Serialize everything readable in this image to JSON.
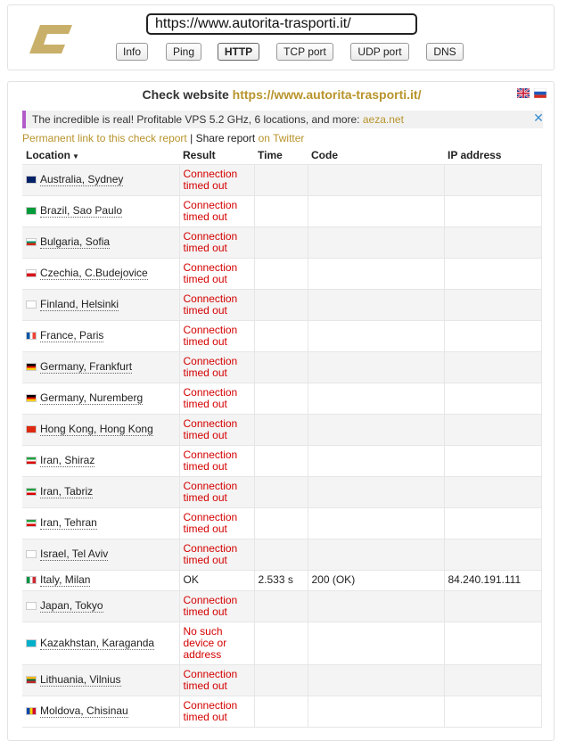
{
  "header": {
    "logo_icon": "c-letter-logo-icon",
    "url_value": "https://www.autorita-trasporti.it/",
    "tools": [
      {
        "label": "Info",
        "active": false
      },
      {
        "label": "Ping",
        "active": false
      },
      {
        "label": "HTTP",
        "active": true
      },
      {
        "label": "TCP port",
        "active": false
      },
      {
        "label": "UDP port",
        "active": false
      },
      {
        "label": "DNS",
        "active": false
      }
    ]
  },
  "check": {
    "title_prefix": "Check website",
    "title_url": "https://www.autorita-trasporti.it/",
    "language_icons": [
      "uk-flag-icon",
      "ru-flag-icon"
    ]
  },
  "ad": {
    "text": "The incredible is real! Profitable VPS 5.2 GHz, 6 locations, and more: ",
    "link": "aeza.net",
    "close_icon": "close-icon"
  },
  "links": {
    "permalink": "Permanent link to this check report",
    "separator": " | ",
    "share": "Share report ",
    "twitter": "on Twitter"
  },
  "table": {
    "headers": {
      "location": "Location",
      "result": "Result",
      "time": "Time",
      "code": "Code",
      "ip": "IP address"
    },
    "sort_icon": "sort-down-icon",
    "rows": [
      {
        "flag": "au",
        "location": "Australia, Sydney",
        "result": "Connection timed out",
        "time": "",
        "code": "",
        "ip": ""
      },
      {
        "flag": "br",
        "location": "Brazil, Sao Paulo",
        "result": "Connection timed out",
        "time": "",
        "code": "",
        "ip": ""
      },
      {
        "flag": "bg",
        "location": "Bulgaria, Sofia",
        "result": "Connection timed out",
        "time": "",
        "code": "",
        "ip": ""
      },
      {
        "flag": "cz",
        "location": "Czechia, C.Budejovice",
        "result": "Connection timed out",
        "time": "",
        "code": "",
        "ip": ""
      },
      {
        "flag": "fi",
        "location": "Finland, Helsinki",
        "result": "Connection timed out",
        "time": "",
        "code": "",
        "ip": ""
      },
      {
        "flag": "fr",
        "location": "France, Paris",
        "result": "Connection timed out",
        "time": "",
        "code": "",
        "ip": ""
      },
      {
        "flag": "de",
        "location": "Germany, Frankfurt",
        "result": "Connection timed out",
        "time": "",
        "code": "",
        "ip": ""
      },
      {
        "flag": "de",
        "location": "Germany, Nuremberg",
        "result": "Connection timed out",
        "time": "",
        "code": "",
        "ip": ""
      },
      {
        "flag": "hk",
        "location": "Hong Kong, Hong Kong",
        "result": "Connection timed out",
        "time": "",
        "code": "",
        "ip": ""
      },
      {
        "flag": "ir",
        "location": "Iran, Shiraz",
        "result": "Connection timed out",
        "time": "",
        "code": "",
        "ip": ""
      },
      {
        "flag": "ir",
        "location": "Iran, Tabriz",
        "result": "Connection timed out",
        "time": "",
        "code": "",
        "ip": ""
      },
      {
        "flag": "ir",
        "location": "Iran, Tehran",
        "result": "Connection timed out",
        "time": "",
        "code": "",
        "ip": ""
      },
      {
        "flag": "il",
        "location": "Israel, Tel Aviv",
        "result": "Connection timed out",
        "time": "",
        "code": "",
        "ip": ""
      },
      {
        "flag": "it",
        "location": "Italy, Milan",
        "result": "OK",
        "time": "2.533 s",
        "code": "200 (OK)",
        "ip": "84.240.191.111"
      },
      {
        "flag": "jp",
        "location": "Japan, Tokyo",
        "result": "Connection timed out",
        "time": "",
        "code": "",
        "ip": ""
      },
      {
        "flag": "kz",
        "location": "Kazakhstan, Karaganda",
        "result": "No such device or address",
        "time": "",
        "code": "",
        "ip": ""
      },
      {
        "flag": "lt",
        "location": "Lithuania, Vilnius",
        "result": "Connection timed out",
        "time": "",
        "code": "",
        "ip": ""
      },
      {
        "flag": "md",
        "location": "Moldova, Chisinau",
        "result": "Connection timed out",
        "time": "",
        "code": "",
        "ip": ""
      }
    ]
  },
  "colors": {
    "gold": "#b8942c",
    "error": "#d40000",
    "ad_accent": "#b25bc8"
  }
}
